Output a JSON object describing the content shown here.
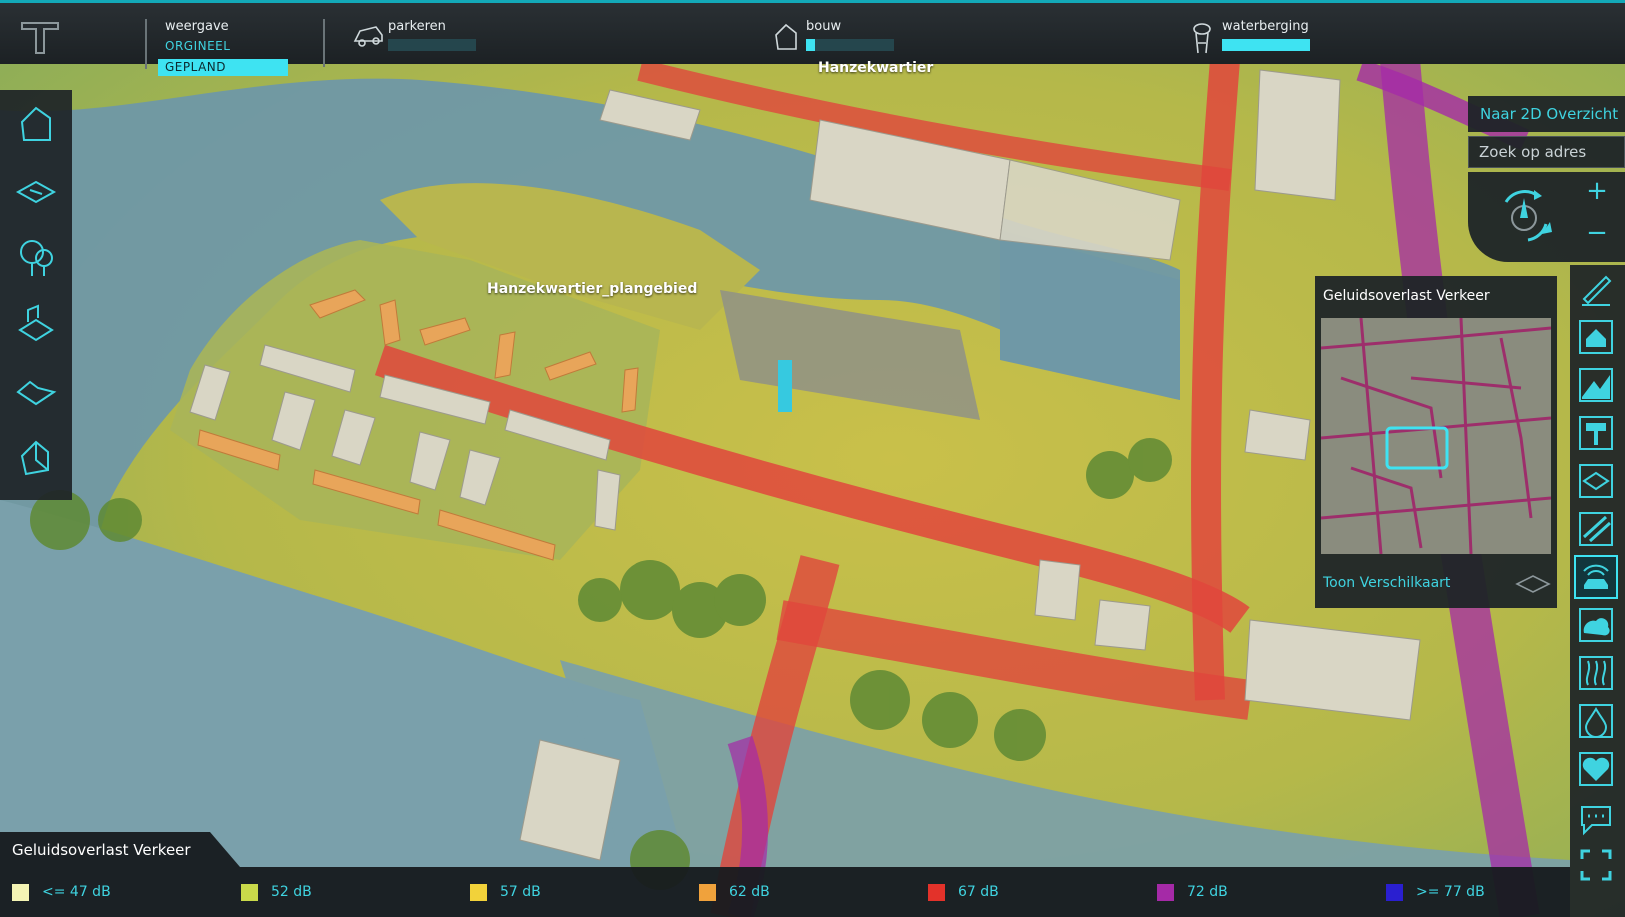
{
  "topbar": {
    "view": {
      "label": "weergave",
      "original": "ORGINEEL",
      "planned": "GEPLAND"
    },
    "indicators": [
      {
        "name": "parkeren",
        "icon": "car-icon",
        "fill": 0.0
      },
      {
        "name": "bouw",
        "icon": "house-icon",
        "fill": 0.1
      },
      {
        "name": "waterberging",
        "icon": "water-tower-icon",
        "fill": 1.0
      }
    ]
  },
  "map": {
    "labels": {
      "area_top": "Hanzekwartier",
      "plan_area": "Hanzekwartier_plangebied"
    }
  },
  "nav": {
    "to_2d": "Naar 2D Overzicht",
    "search_placeholder": "Zoek op adres",
    "zoom_in": "+",
    "zoom_out": "−"
  },
  "overlay_panel": {
    "title": "Geluidsoverlast Verkeer",
    "difference_map": "Toon Verschilkaart"
  },
  "legend": {
    "title": "Geluidsoverlast Verkeer",
    "items": [
      {
        "label": "<= 47 dB",
        "color": "#f4f4b4"
      },
      {
        "label": "52 dB",
        "color": "#c9d94a"
      },
      {
        "label": "57 dB",
        "color": "#f2d23a"
      },
      {
        "label": "62 dB",
        "color": "#f0a23c"
      },
      {
        "label": "67 dB",
        "color": "#e3322a"
      },
      {
        "label": "72 dB",
        "color": "#a52aa7"
      },
      {
        "label": ">= 77 dB",
        "color": "#2a1fd0"
      }
    ]
  },
  "colors": {
    "accent": "#3ee3f2",
    "panel": "#1e2427"
  }
}
